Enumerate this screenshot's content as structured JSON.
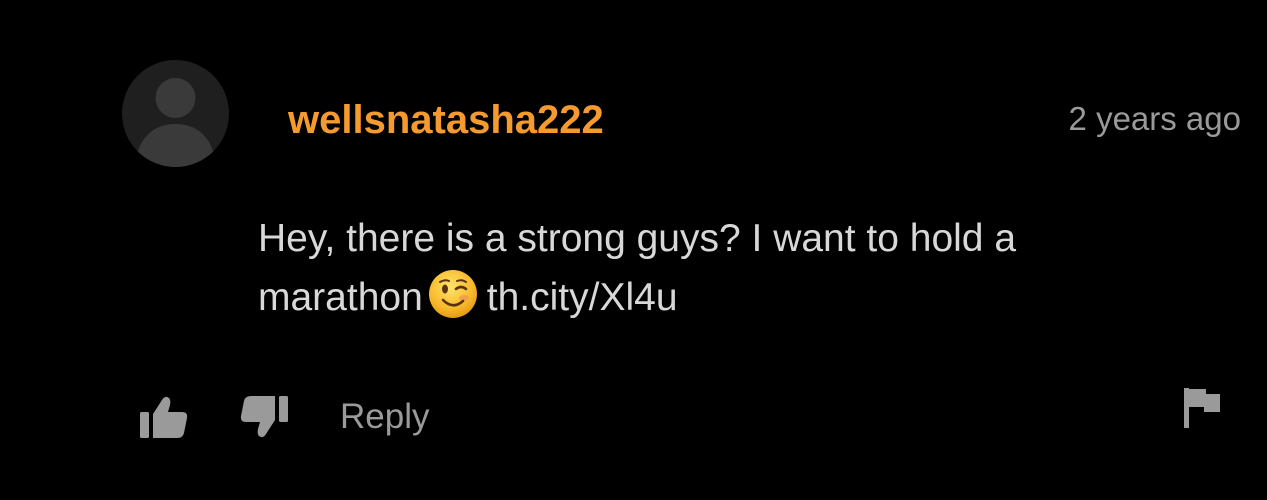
{
  "comment": {
    "username": "wellsnatasha222",
    "timestamp": "2 years ago",
    "body_line1": "Hey, there is a strong guys? I want to hold a",
    "body_word": "marathon",
    "emoji": "winking-face-emoji",
    "link": "th.city/Xl4u"
  },
  "actions": {
    "reply_label": "Reply",
    "like_icon": "thumbs-up-icon",
    "dislike_icon": "thumbs-down-icon",
    "flag_icon": "flag-icon"
  },
  "colors": {
    "background": "#000000",
    "username": "#f59a2e",
    "body_text": "#d8d8d8",
    "muted": "#9a9a9a",
    "avatar_bg": "#1f1f1f",
    "avatar_silhouette": "#3a3a3a"
  }
}
